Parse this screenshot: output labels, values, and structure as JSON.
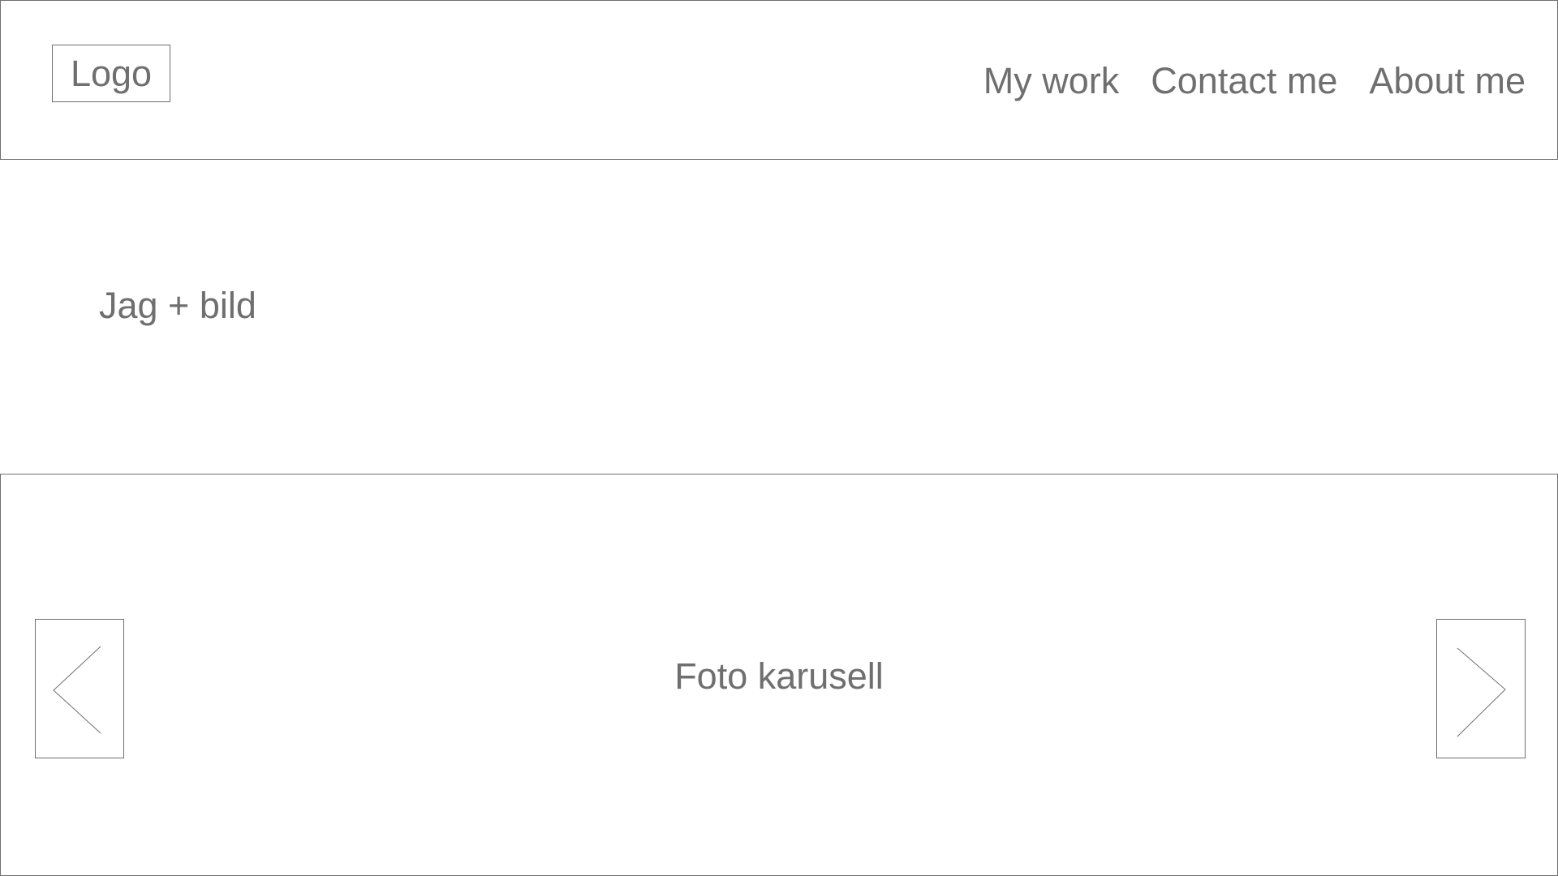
{
  "header": {
    "logo": "Logo",
    "nav": [
      {
        "label": "My work"
      },
      {
        "label": "Contact me"
      },
      {
        "label": "About me"
      }
    ]
  },
  "intro": {
    "text": "Jag + bild"
  },
  "carousel": {
    "label": "Foto karusell",
    "prev_icon": "chevron-left-icon",
    "next_icon": "chevron-right-icon"
  },
  "colors": {
    "text": "#6f6f6f",
    "border": "#6f6f6f",
    "background": "#ffffff"
  }
}
